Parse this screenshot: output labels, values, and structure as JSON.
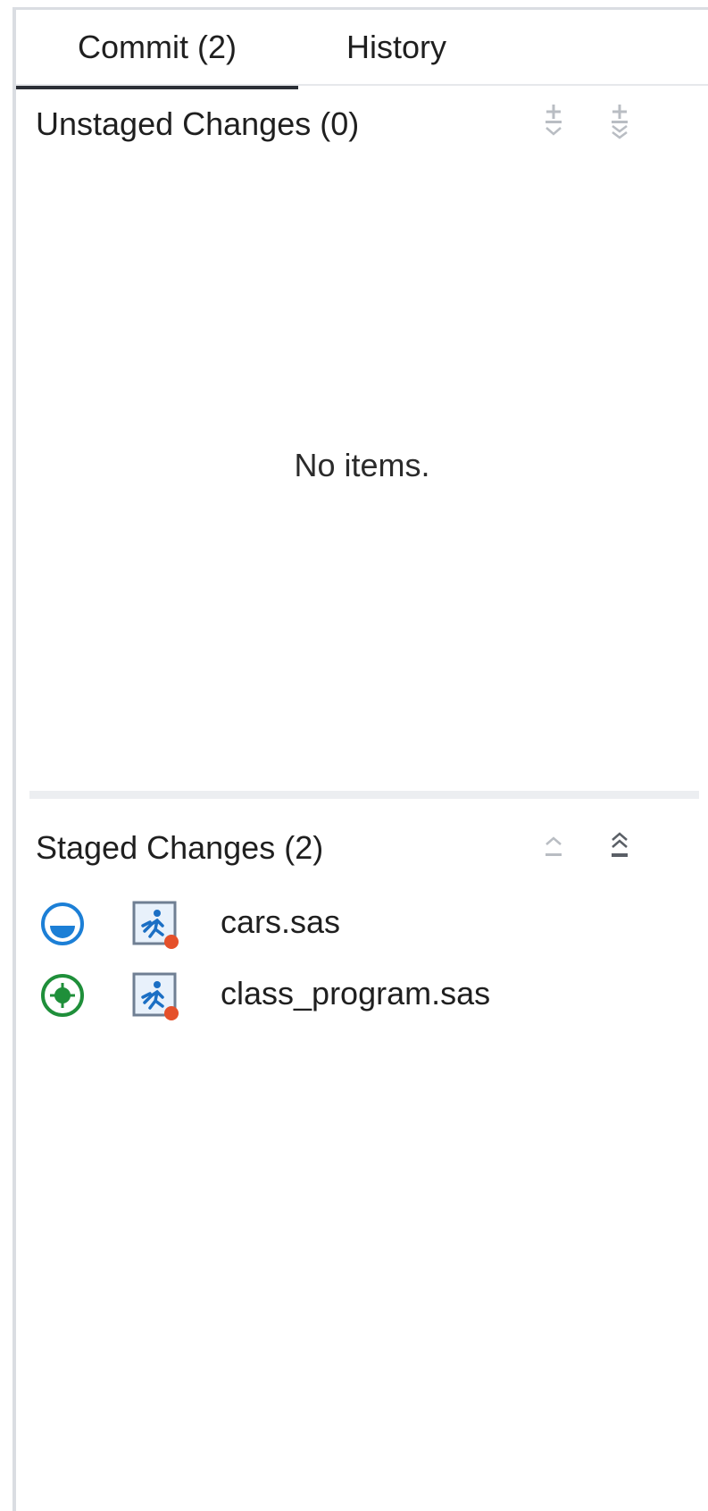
{
  "tabs": {
    "commit_label": "Commit (2)",
    "history_label": "History"
  },
  "unstaged": {
    "title": "Unstaged Changes (0)",
    "empty_text": "No items.",
    "actions": [
      "stage-selected-icon",
      "stage-all-icon"
    ]
  },
  "staged": {
    "title": "Staged Changes (2)",
    "actions": [
      "unstage-selected-icon",
      "unstage-all-icon"
    ],
    "files": [
      {
        "name": "cars.sas",
        "status_icon": "deleted-status-icon",
        "status_color": "#1c7fd6",
        "file_icon": "sas-program-icon"
      },
      {
        "name": "class_program.sas",
        "status_icon": "added-status-icon",
        "status_color": "#1f8f3a",
        "file_icon": "sas-program-icon"
      }
    ]
  },
  "colors": {
    "border": "#dadde2",
    "tab_underline": "#2b2f36",
    "splitter": "#eceef1",
    "disabled_icon": "#b9bdc3",
    "sas_icon_blue": "#1b6fc4",
    "sas_icon_badge": "#e5502a"
  }
}
